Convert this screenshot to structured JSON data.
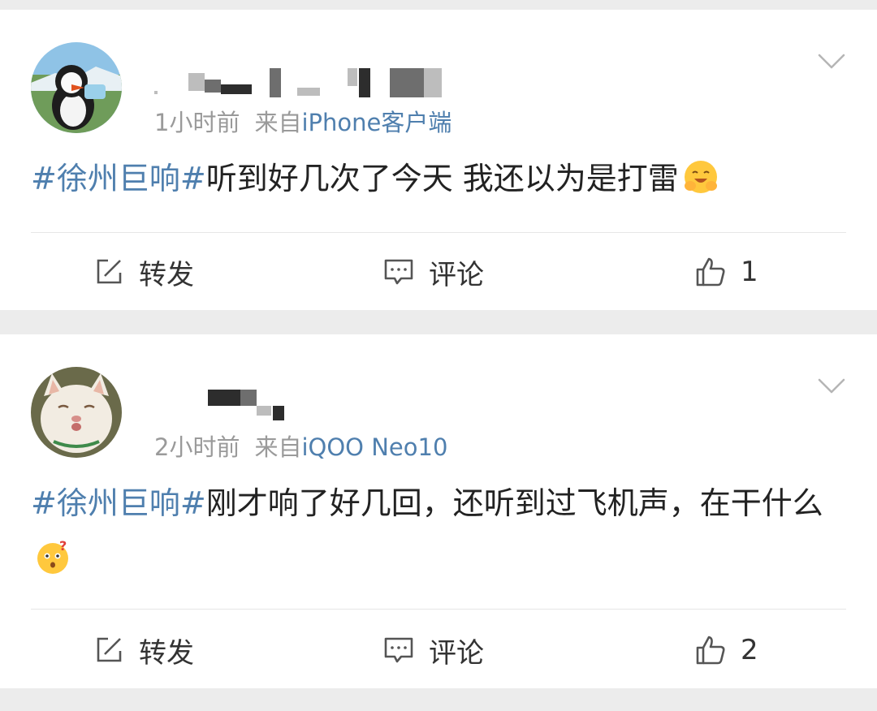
{
  "posts": [
    {
      "time": "1小时前",
      "source_prefix": "来自",
      "device": "iPhone客户端",
      "hashtag": "#徐州巨响#",
      "text": "听到好几次了今天 我还以为是打雷",
      "emoji": "hug-emoji",
      "actions": {
        "repost": "转发",
        "comment": "评论",
        "like": "1"
      }
    },
    {
      "time": "2小时前",
      "source_prefix": "来自",
      "device": "iQOO Neo10",
      "hashtag": "#徐州巨响#",
      "text": "刚才响了好几回，还听到过飞机声，在干什么",
      "emoji": "thinking-question-emoji",
      "actions": {
        "repost": "转发",
        "comment": "评论",
        "like": "2"
      }
    }
  ],
  "colors": {
    "link": "#4f7fae",
    "meta": "#9a9a9a",
    "background": "#ececec"
  },
  "icons": [
    "chevron-down-icon",
    "repost-icon",
    "comment-icon",
    "like-icon"
  ]
}
